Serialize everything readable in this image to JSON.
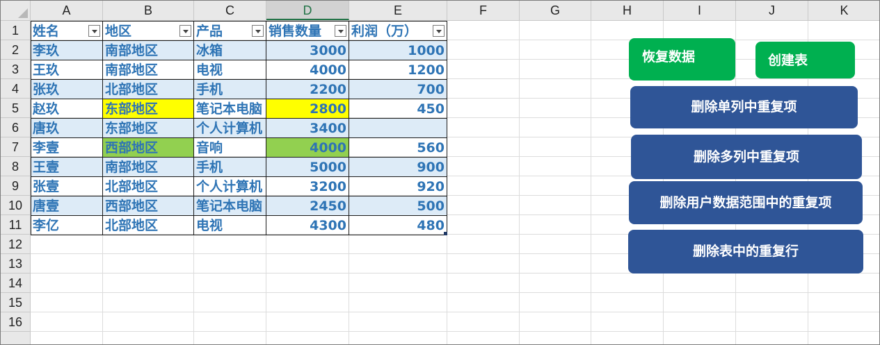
{
  "columns": [
    "A",
    "B",
    "C",
    "D",
    "E",
    "F",
    "G",
    "H",
    "I",
    "J",
    "K"
  ],
  "rows": [
    "1",
    "2",
    "3",
    "4",
    "5",
    "6",
    "7",
    "8",
    "9",
    "10",
    "11",
    "12",
    "13",
    "14",
    "15",
    "16"
  ],
  "table": {
    "headers": [
      "姓名",
      "地区",
      "产品",
      "销售数量",
      "利润（万）"
    ],
    "data": [
      [
        "李玖",
        "南部地区",
        "冰箱",
        "3000",
        "1000"
      ],
      [
        "王玖",
        "南部地区",
        "电视",
        "4000",
        "1200"
      ],
      [
        "张玖",
        "北部地区",
        "手机",
        "2200",
        "700"
      ],
      [
        "赵玖",
        "东部地区",
        "笔记本电脑",
        "2800",
        "450"
      ],
      [
        "唐玖",
        "东部地区",
        "个人计算机",
        "3400",
        ""
      ],
      [
        "李壹",
        "西部地区",
        "音响",
        "4000",
        "560"
      ],
      [
        "王壹",
        "南部地区",
        "手机",
        "5000",
        "900"
      ],
      [
        "张壹",
        "北部地区",
        "个人计算机",
        "3200",
        "920"
      ],
      [
        "唐壹",
        "西部地区",
        "笔记本电脑",
        "2450",
        "500"
      ],
      [
        "李亿",
        "北部地区",
        "电视",
        "4300",
        "480"
      ]
    ]
  },
  "buttons": {
    "restore": "恢复数据",
    "create_table": "创建表",
    "remove_single": "删除单列中重复项",
    "remove_multi": "删除多列中重复项",
    "remove_range": "删除用户数据范围中的重复项",
    "remove_table_rows": "删除表中的重复行"
  },
  "colors": {
    "text_blue": "#2e74b5",
    "band": "#ddebf7",
    "highlight_yellow": "#ffff00",
    "highlight_green": "#92d050",
    "button_green": "#00b050",
    "button_blue": "#2f5597"
  }
}
